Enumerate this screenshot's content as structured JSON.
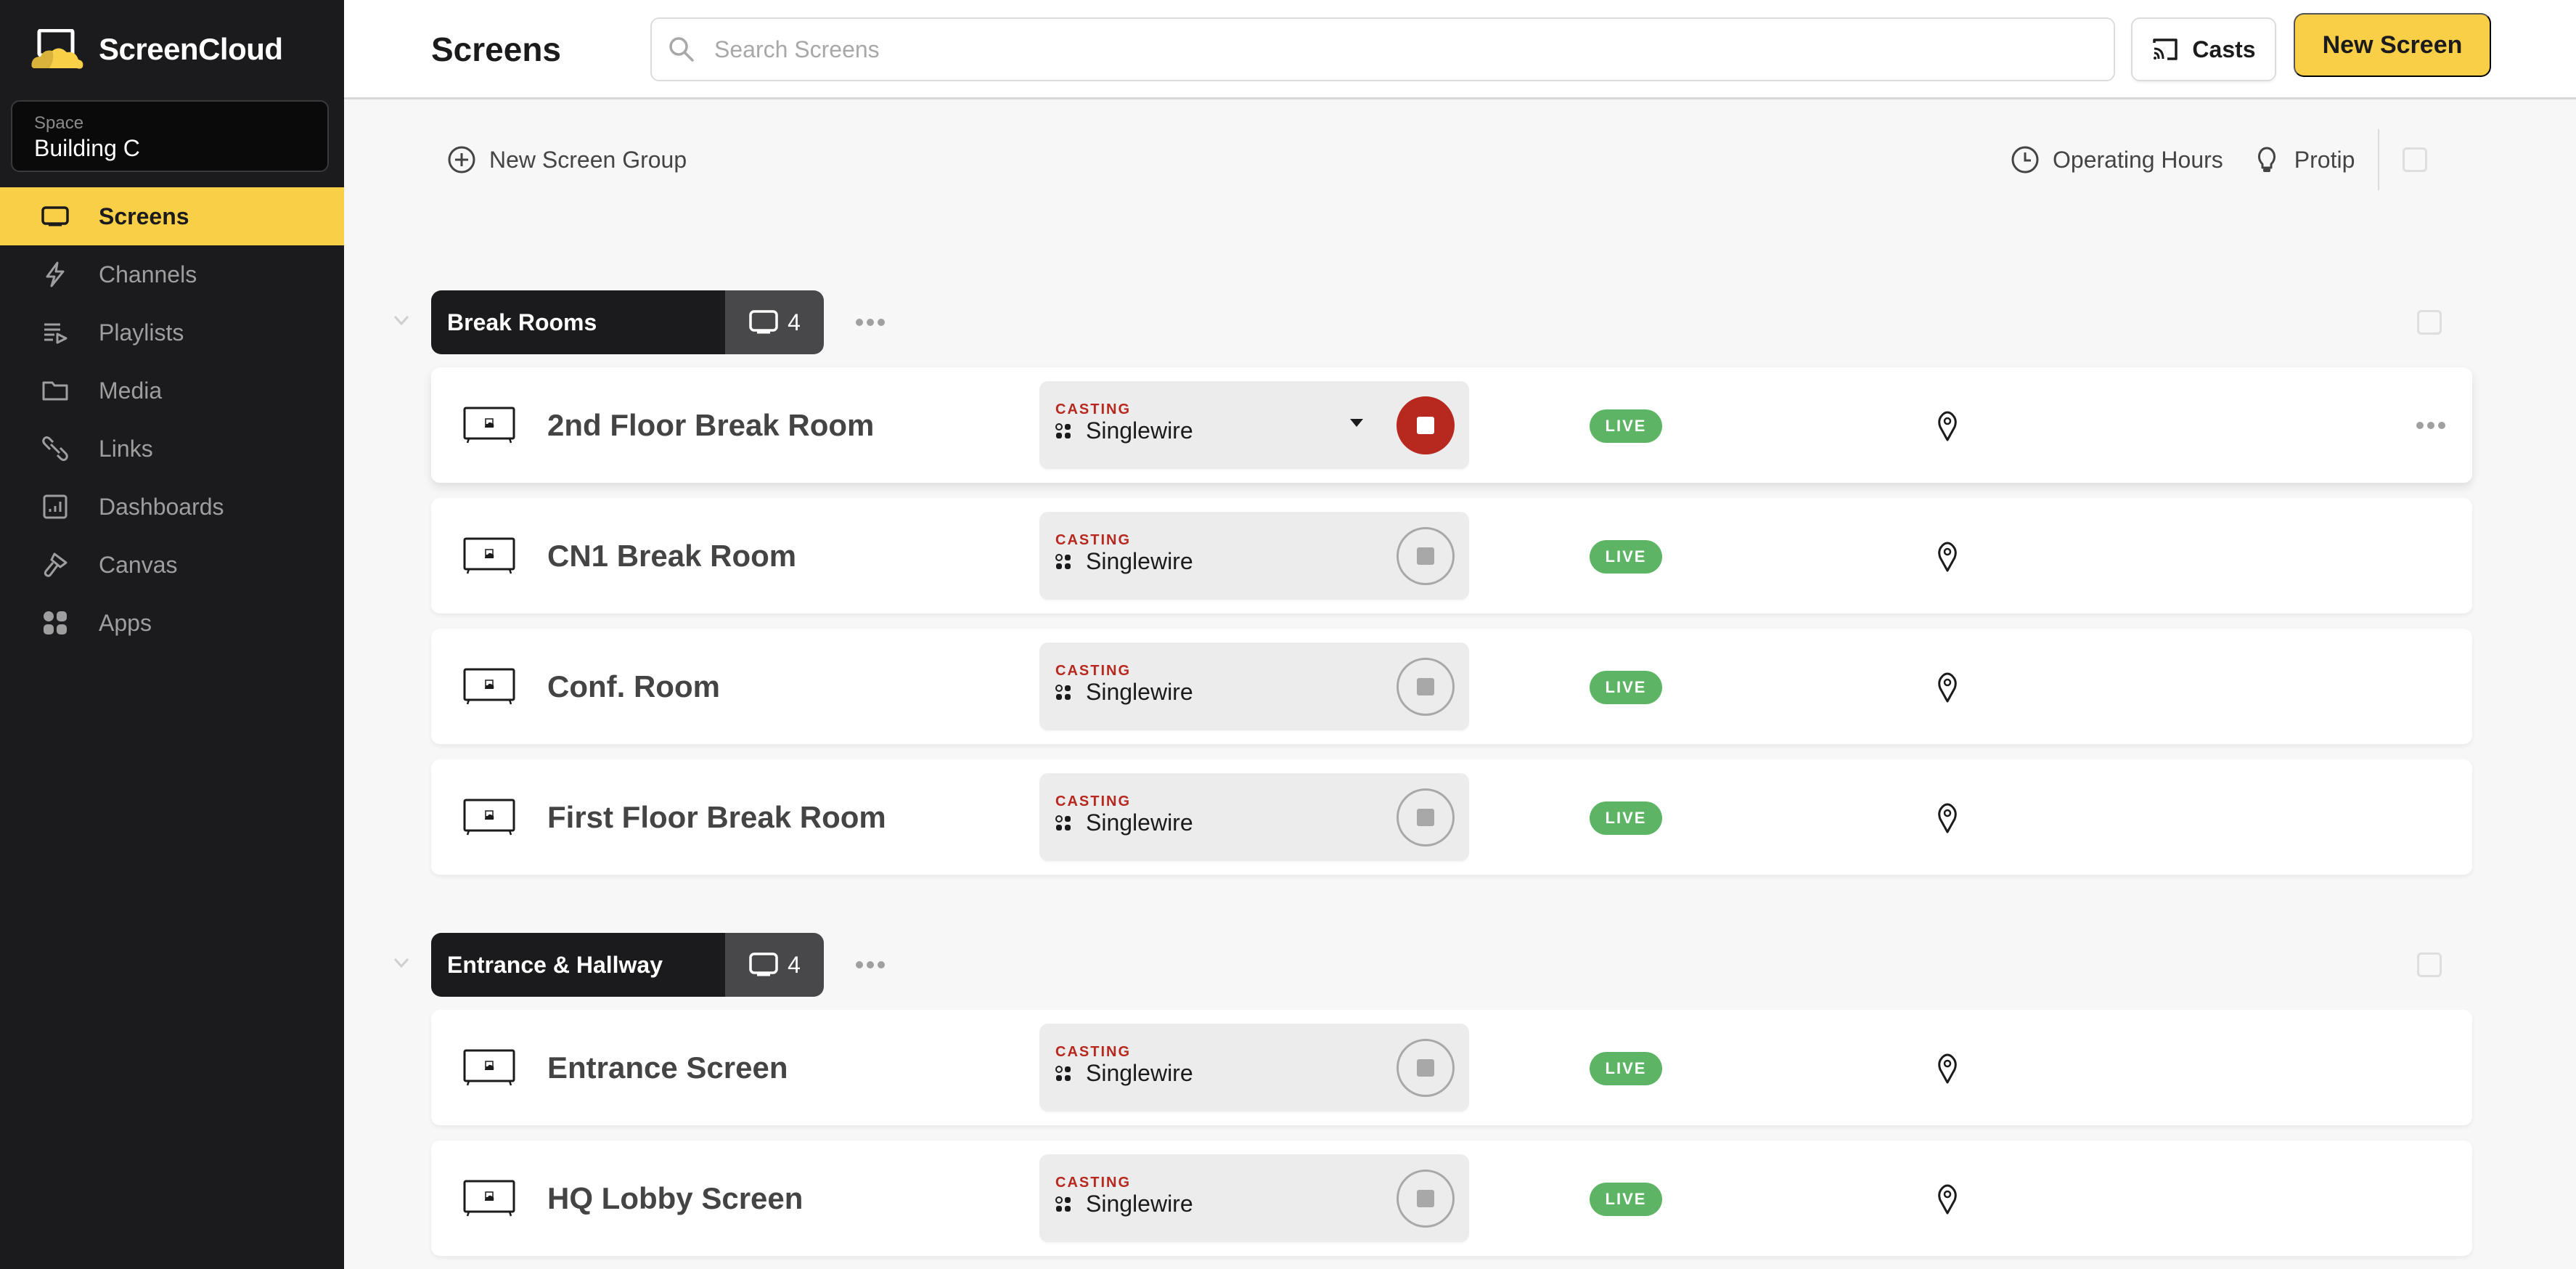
{
  "app": {
    "name": "ScreenCloud",
    "brand_color": "#f8cf46"
  },
  "space": {
    "label": "Space",
    "value": "Building C"
  },
  "sidebar": {
    "items": [
      {
        "label": "Screens",
        "icon": "screen-icon",
        "active": true
      },
      {
        "label": "Channels",
        "icon": "lightning-icon",
        "active": false
      },
      {
        "label": "Playlists",
        "icon": "playlist-icon",
        "active": false
      },
      {
        "label": "Media",
        "icon": "folder-icon",
        "active": false
      },
      {
        "label": "Links",
        "icon": "link-icon",
        "active": false
      },
      {
        "label": "Dashboards",
        "icon": "dashboard-icon",
        "active": false
      },
      {
        "label": "Canvas",
        "icon": "brush-icon",
        "active": false
      },
      {
        "label": "Apps",
        "icon": "apps-icon",
        "active": false
      }
    ]
  },
  "header": {
    "title": "Screens",
    "search_placeholder": "Search Screens",
    "search_value": "",
    "casts_label": "Casts",
    "new_screen_label": "New Screen"
  },
  "toolbar": {
    "new_group_label": "New Screen Group",
    "operating_hours_label": "Operating Hours",
    "protip_label": "Protip"
  },
  "groups": [
    {
      "name": "Break Rooms",
      "count": "4",
      "screens": [
        {
          "name": "2nd Floor Break Room",
          "casting_label": "CASTING",
          "cast_app": "Singlewire",
          "status": "LIVE",
          "stop_active": true
        },
        {
          "name": "CN1 Break Room",
          "casting_label": "CASTING",
          "cast_app": "Singlewire",
          "status": "LIVE",
          "stop_active": false
        },
        {
          "name": "Conf. Room",
          "casting_label": "CASTING",
          "cast_app": "Singlewire",
          "status": "LIVE",
          "stop_active": false
        },
        {
          "name": "First Floor Break Room",
          "casting_label": "CASTING",
          "cast_app": "Singlewire",
          "status": "LIVE",
          "stop_active": false
        }
      ]
    },
    {
      "name": "Entrance & Hallway",
      "count": "4",
      "screens": [
        {
          "name": "Entrance Screen",
          "casting_label": "CASTING",
          "cast_app": "Singlewire",
          "status": "LIVE",
          "stop_active": false
        },
        {
          "name": "HQ Lobby Screen",
          "casting_label": "CASTING",
          "cast_app": "Singlewire",
          "status": "LIVE",
          "stop_active": false
        }
      ]
    }
  ],
  "colors": {
    "casting": "#b7281e",
    "live": "#5cb464",
    "stop_active": "#b7281e"
  }
}
